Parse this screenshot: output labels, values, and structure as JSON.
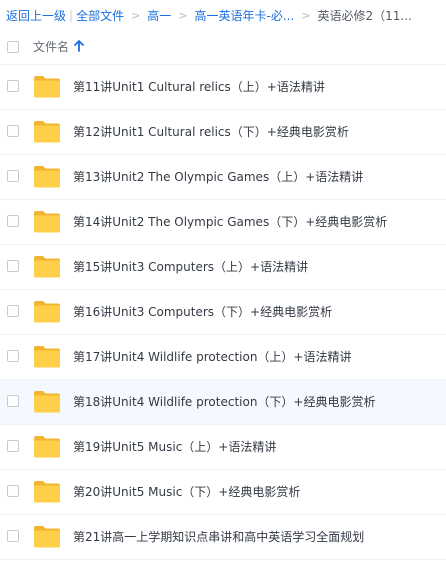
{
  "breadcrumb": {
    "back": "返回上一级",
    "all_files": "全部文件",
    "level1": "高一",
    "level2": "高一英语年卡-必...",
    "current": "英语必修2（11...",
    "separator": ">"
  },
  "list_header": {
    "column_name": "文件名",
    "sort_icon": "arrow-up-icon"
  },
  "colors": {
    "link": "#1c6fe0",
    "folder": "#ffcf4a",
    "hover_row": "#f5f8fe"
  },
  "files": [
    {
      "name": "第11讲Unit1 Cultural relics（上）+语法精讲",
      "type": "folder"
    },
    {
      "name": "第12讲Unit1 Cultural relics（下）+经典电影赏析",
      "type": "folder"
    },
    {
      "name": "第13讲Unit2 The Olympic Games（上）+语法精讲",
      "type": "folder"
    },
    {
      "name": "第14讲Unit2 The Olympic Games（下）+经典电影赏析",
      "type": "folder"
    },
    {
      "name": "第15讲Unit3 Computers（上）+语法精讲",
      "type": "folder"
    },
    {
      "name": "第16讲Unit3 Computers（下）+经典电影赏析",
      "type": "folder"
    },
    {
      "name": "第17讲Unit4 Wildlife protection（上）+语法精讲",
      "type": "folder"
    },
    {
      "name": "第18讲Unit4 Wildlife protection（下）+经典电影赏析",
      "type": "folder",
      "hovered": true
    },
    {
      "name": "第19讲Unit5 Music（上）+语法精讲",
      "type": "folder"
    },
    {
      "name": "第20讲Unit5 Music（下）+经典电影赏析",
      "type": "folder"
    },
    {
      "name": "第21讲高一上学期知识点串讲和高中英语学习全面规划",
      "type": "folder"
    }
  ]
}
